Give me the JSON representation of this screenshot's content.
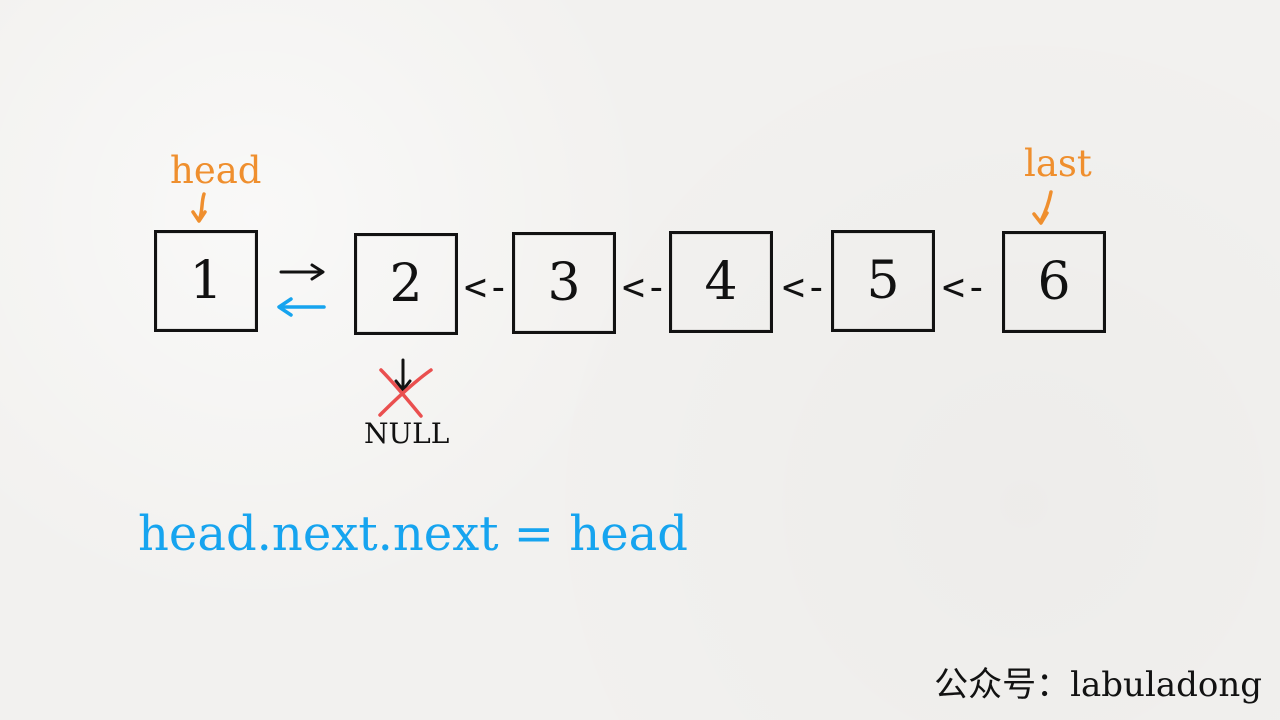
{
  "diagram": {
    "labels": {
      "head": "head",
      "last": "last"
    },
    "nodes": [
      "1",
      "2",
      "3",
      "4",
      "5",
      "6"
    ],
    "links": [
      "<-",
      "<-",
      "<-",
      "<-"
    ],
    "null": "NULL",
    "code": "head.next.next = head",
    "footer": "公众号：labuladong",
    "colors": {
      "orange": "#ef8f2e",
      "blue": "#16a4ef",
      "red": "#ea4f4f",
      "black": "#121212"
    },
    "icons": [
      "down-arrow-icon",
      "right-arrow-icon",
      "left-arrow-icon",
      "cross-icon"
    ]
  }
}
